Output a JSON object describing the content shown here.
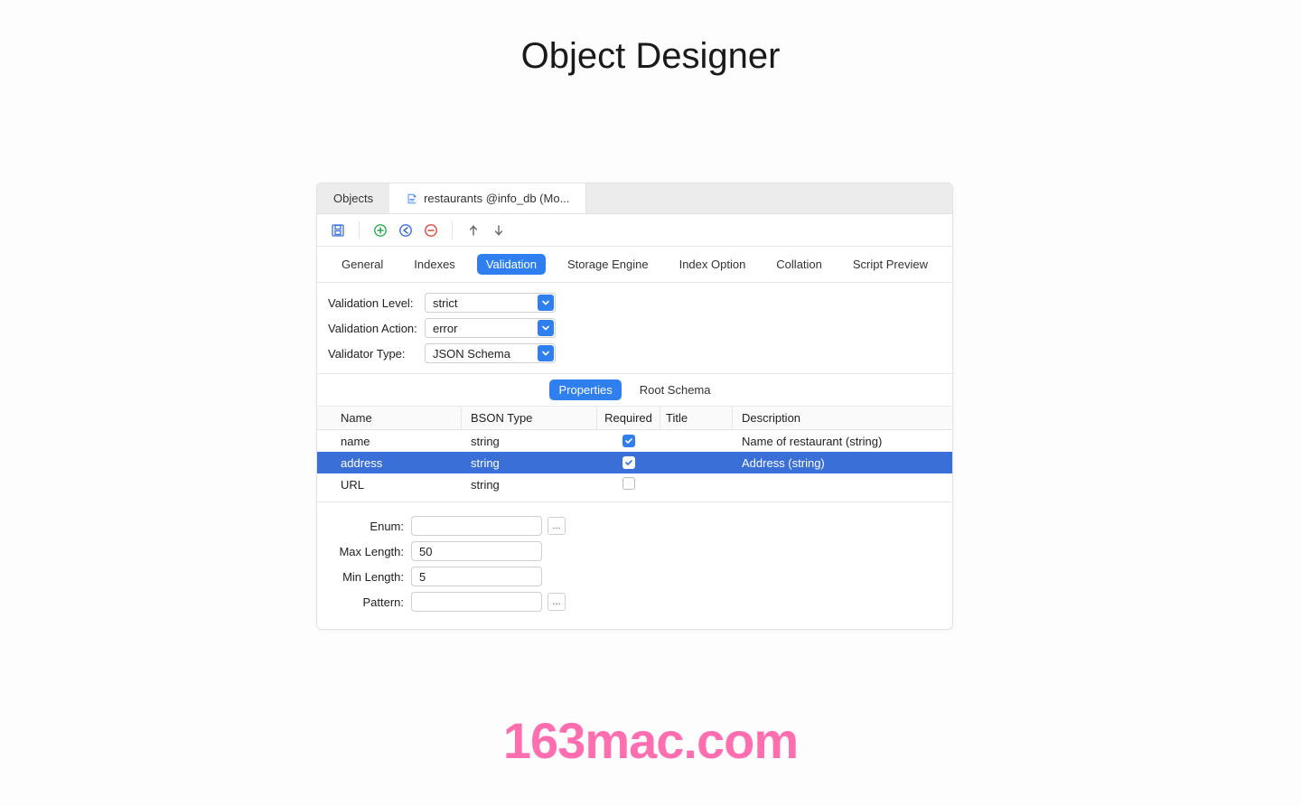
{
  "page_title": "Object Designer",
  "watermark": "163mac.com",
  "tabstrip": {
    "tabs": [
      {
        "label": "Objects",
        "active": false
      },
      {
        "label": "restaurants @info_db (Mo...",
        "active": true
      }
    ]
  },
  "main_tabs": [
    {
      "label": "General",
      "active": false
    },
    {
      "label": "Indexes",
      "active": false
    },
    {
      "label": "Validation",
      "active": true
    },
    {
      "label": "Storage Engine",
      "active": false
    },
    {
      "label": "Index Option",
      "active": false
    },
    {
      "label": "Collation",
      "active": false
    },
    {
      "label": "Script Preview",
      "active": false
    }
  ],
  "validation_form": {
    "level": {
      "label": "Validation Level:",
      "value": "strict"
    },
    "action": {
      "label": "Validation Action:",
      "value": "error"
    },
    "vtype": {
      "label": "Validator Type:",
      "value": "JSON Schema"
    }
  },
  "sub_tabs": [
    {
      "label": "Properties",
      "active": true
    },
    {
      "label": "Root Schema",
      "active": false
    }
  ],
  "columns": {
    "name": "Name",
    "bson": "BSON Type",
    "required": "Required",
    "title": "Title",
    "description": "Description"
  },
  "rows": [
    {
      "name": "name",
      "bson": "string",
      "required": true,
      "title": "",
      "description": "Name of restaurant (string)",
      "selected": false
    },
    {
      "name": "address",
      "bson": "string",
      "required": true,
      "title": "",
      "description": "Address (string)",
      "selected": true
    },
    {
      "name": "URL",
      "bson": "string",
      "required": false,
      "title": "",
      "description": "",
      "selected": false
    }
  ],
  "detail": {
    "enum": {
      "label": "Enum:",
      "value": ""
    },
    "max_length": {
      "label": "Max Length:",
      "value": "50"
    },
    "min_length": {
      "label": "Min Length:",
      "value": "5"
    },
    "pattern": {
      "label": "Pattern:",
      "value": ""
    }
  },
  "more_button_label": "..."
}
